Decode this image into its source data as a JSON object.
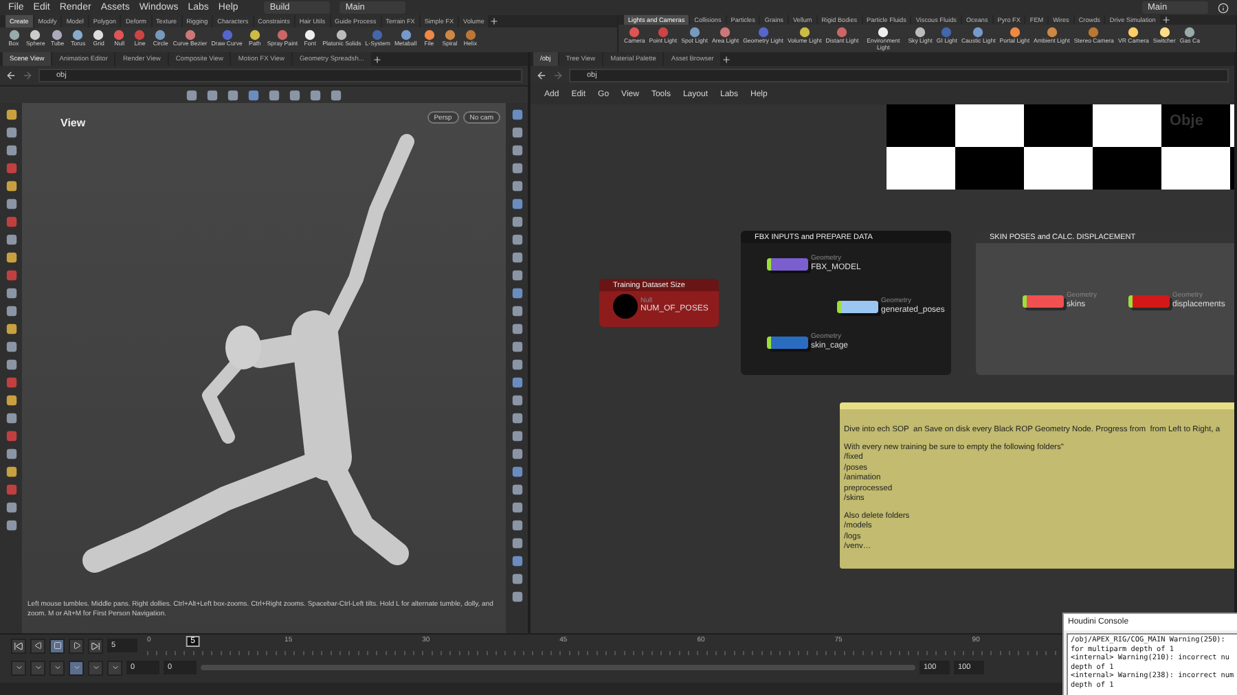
{
  "menu_bar": {
    "items": [
      "File",
      "Edit",
      "Render",
      "Assets",
      "Windows",
      "Labs",
      "Help"
    ],
    "desktops": [
      "Build",
      "Main"
    ],
    "right_desktop": "Main"
  },
  "shelf_left": {
    "tabs": [
      {
        "label": "Create",
        "selected": true
      },
      {
        "label": "Modify",
        "selected": false
      },
      {
        "label": "Model",
        "selected": false
      },
      {
        "label": "Polygon",
        "selected": false
      },
      {
        "label": "Deform",
        "selected": false
      },
      {
        "label": "Texture",
        "selected": false
      },
      {
        "label": "Rigging",
        "selected": false
      },
      {
        "label": "Characters",
        "selected": false
      },
      {
        "label": "Constraints",
        "selected": false
      },
      {
        "label": "Hair Utils",
        "selected": false
      },
      {
        "label": "Guide Process",
        "selected": false
      },
      {
        "label": "Terrain FX",
        "selected": false
      },
      {
        "label": "Simple FX",
        "selected": false
      },
      {
        "label": "Volume",
        "selected": false
      }
    ],
    "tools": [
      "Box",
      "Sphere",
      "Tube",
      "Torus",
      "Grid",
      "Null",
      "Line",
      "Circle",
      "Curve Bezier",
      "Draw Curve",
      "Path",
      "Spray Paint",
      "Font",
      "Platonic Solids",
      "L-System",
      "Metaball",
      "File",
      "Spiral",
      "Helix"
    ]
  },
  "shelf_right": {
    "tabs": [
      {
        "label": "Lights and Cameras",
        "selected": true
      },
      {
        "label": "Collisions",
        "selected": false
      },
      {
        "label": "Particles",
        "selected": false
      },
      {
        "label": "Grains",
        "selected": false
      },
      {
        "label": "Vellum",
        "selected": false
      },
      {
        "label": "Rigid Bodies",
        "selected": false
      },
      {
        "label": "Particle Fluids",
        "selected": false
      },
      {
        "label": "Viscous Fluids",
        "selected": false
      },
      {
        "label": "Oceans",
        "selected": false
      },
      {
        "label": "Pyro FX",
        "selected": false
      },
      {
        "label": "FEM",
        "selected": false
      },
      {
        "label": "Wires",
        "selected": false
      },
      {
        "label": "Crowds",
        "selected": false
      },
      {
        "label": "Drive Simulation",
        "selected": false
      }
    ],
    "tools": [
      "Camera",
      "Point Light",
      "Spot Light",
      "Area Light",
      "Geometry Light",
      "Volume Light",
      "Distant Light",
      "Environment Light",
      "Sky Light",
      "GI Light",
      "Caustic Light",
      "Portal Light",
      "Ambient Light",
      "Stereo Camera",
      "VR Camera",
      "Switcher",
      "Gas Ca"
    ]
  },
  "scene_pane": {
    "tabs": [
      {
        "label": "Scene View",
        "selected": true
      },
      {
        "label": "Animation Editor",
        "selected": false
      },
      {
        "label": "Render View",
        "selected": false
      },
      {
        "label": "Composite View",
        "selected": false
      },
      {
        "label": "Motion FX View",
        "selected": false
      },
      {
        "label": "Geometry Spreadsh...",
        "selected": false
      }
    ],
    "path": "obj",
    "viewport_label": "View",
    "camera_buttons": [
      "Persp",
      "No cam"
    ],
    "status": "Left mouse tumbles. Middle pans. Right dollies. Ctrl+Alt+Left box-zooms. Ctrl+Right zooms. Spacebar-Ctrl-Left tilts. Hold L for alternate tumble, dolly, and zoom. M or Alt+M for First Person Navigation."
  },
  "network_pane": {
    "tabs": [
      {
        "label": "/obj",
        "selected": true
      },
      {
        "label": "Tree View",
        "selected": false
      },
      {
        "label": "Material Palette",
        "selected": false
      },
      {
        "label": "Asset Browser",
        "selected": false
      }
    ],
    "path": "obj",
    "menu": [
      "Add",
      "Edit",
      "Go",
      "View",
      "Tools",
      "Layout",
      "Labs",
      "Help"
    ],
    "image_text": "Obje",
    "boxes": [
      {
        "title": "Training Dataset Size",
        "color": "#8e1c1c",
        "nodes": [
          {
            "kind": "null",
            "type": "Null",
            "name": "NUM_OF_POSES",
            "color": "#000000"
          }
        ]
      },
      {
        "title": "FBX INPUTS and PREPARE DATA",
        "color": "#1c1c1c",
        "nodes": [
          {
            "kind": "geo",
            "type": "Geometry",
            "name": "FBX_MODEL",
            "color": "#7b5fd0"
          },
          {
            "kind": "geo",
            "type": "Geometry",
            "name": "skin_cage",
            "color": "#2a6cc0"
          },
          {
            "kind": "geo",
            "type": "Geometry",
            "name": "generated_poses",
            "color": "#9cc6f2"
          }
        ]
      },
      {
        "title": "SKIN POSES and CALC. DISPLACEMENT",
        "color": "#464646",
        "nodes": [
          {
            "kind": "geo",
            "type": "Geometry",
            "name": "skins",
            "color": "#f05050"
          },
          {
            "kind": "geo",
            "type": "Geometry",
            "name": "displacements",
            "color": "#d41818"
          }
        ]
      }
    ],
    "note": {
      "paragraphs": [
        [
          "Dive into ech SOP  an Save on disk every Black ROP Geometry Node. Progress from  from Left to Right, a"
        ],
        [
          "With every new training be sure to empty the following folders\"",
          "/fixed",
          "/poses",
          "/animation",
          "preprocessed",
          "/skins"
        ],
        [
          "Also delete folders",
          "/models",
          "/logs",
          "/venv…"
        ]
      ]
    }
  },
  "timeline": {
    "frame": "5",
    "frame_marker": "5",
    "range_slider": {
      "level": 1
    },
    "ticks": [
      "0",
      "15",
      "30",
      "45",
      "60",
      "75",
      "90"
    ],
    "start": "0",
    "start2": "0",
    "end": "100",
    "end2": "100"
  },
  "console": {
    "title": "Houdini Console",
    "lines": [
      "/obj/APEX_RIG/COG_MAIN Warning(250):",
      "for multiparm depth of 1",
      "<internal> Warning(210): incorrect nu",
      "depth of 1",
      "<internal> Warning(238): incorrect num",
      "depth of 1"
    ]
  }
}
